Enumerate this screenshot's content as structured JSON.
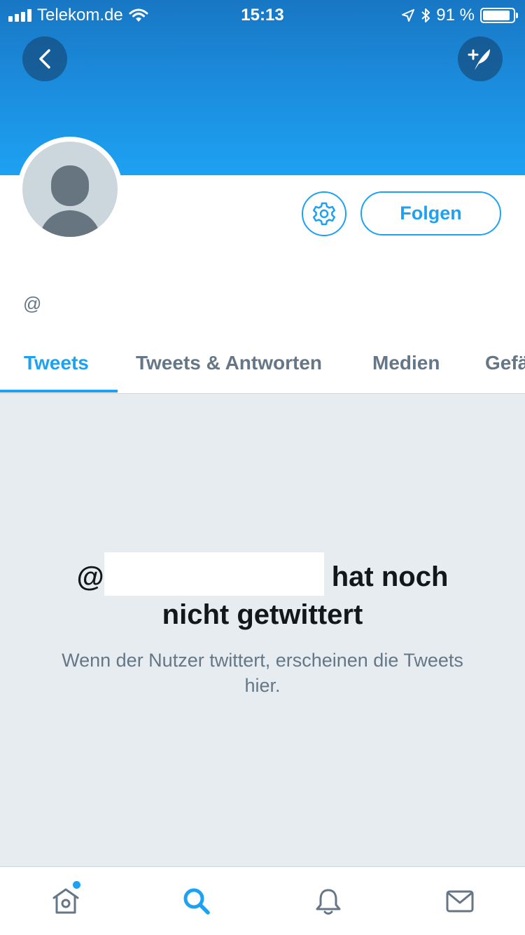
{
  "status_bar": {
    "carrier": "Telekom.de",
    "time": "15:13",
    "battery": "91 %",
    "battery_level": 0.91
  },
  "header": {
    "back_icon": "chevron-left-icon",
    "compose_icon": "compose-tweet-icon"
  },
  "profile": {
    "handle": "@",
    "follow_label": "Folgen",
    "settings_icon": "gear-icon"
  },
  "tabs": [
    {
      "label": "Tweets",
      "active": true
    },
    {
      "label": "Tweets & Antworten",
      "active": false
    },
    {
      "label": "Medien",
      "active": false
    },
    {
      "label": "Gefä",
      "active": false
    }
  ],
  "empty_state": {
    "title_prefix": "@",
    "title_suffix": "hat noch",
    "title_line2": "nicht getwittert",
    "subtitle": "Wenn der Nutzer twittert, erscheinen die Tweets hier."
  },
  "tab_bar": [
    {
      "icon": "home-icon",
      "active": false,
      "has_dot": true
    },
    {
      "icon": "search-icon",
      "active": true,
      "has_dot": false
    },
    {
      "icon": "bell-icon",
      "active": false,
      "has_dot": false
    },
    {
      "icon": "mail-icon",
      "active": false,
      "has_dot": false
    }
  ],
  "colors": {
    "accent": "#1da1f2",
    "text_primary": "#14171a",
    "text_secondary": "#657786",
    "background_empty": "#e6ecf0"
  }
}
